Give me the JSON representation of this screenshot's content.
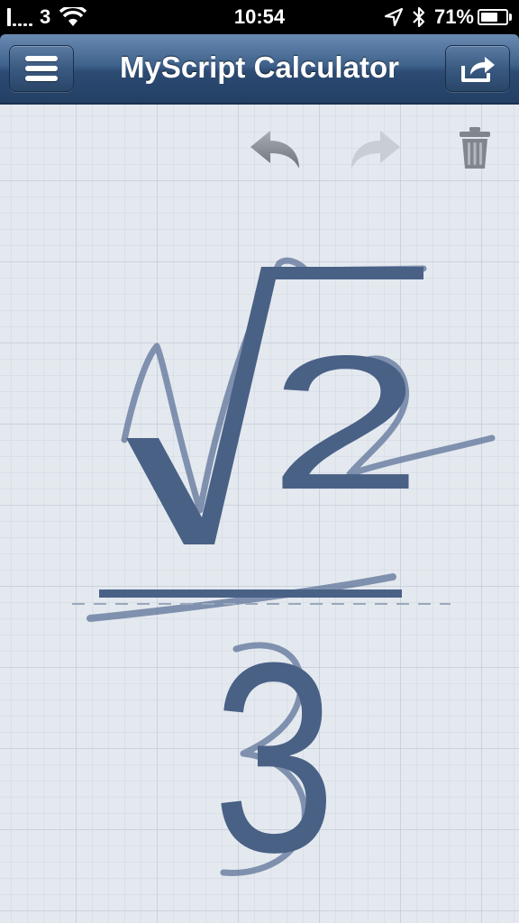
{
  "status_bar": {
    "carrier": "3",
    "time": "10:54",
    "battery_percent_label": "71%",
    "battery_level": 0.71,
    "signal_bars": 1,
    "icons": [
      "signal-icon",
      "wifi-icon",
      "location-icon",
      "bluetooth-icon",
      "battery-icon"
    ]
  },
  "navbar": {
    "title": "MyScript Calculator",
    "menu_icon": "menu-icon",
    "share_icon": "share-icon"
  },
  "toolbar": {
    "undo_icon": "undo-icon",
    "redo_icon": "redo-icon",
    "trash_icon": "trash-icon"
  },
  "expression": {
    "radicand": "2",
    "denominator": "3"
  },
  "colors": {
    "ink": "#4a6186",
    "handwriting": "#5d7398",
    "nav_dark": "#233f63",
    "nav_light": "#6a8bb2",
    "canvas_bg": "#e4e9ef"
  }
}
